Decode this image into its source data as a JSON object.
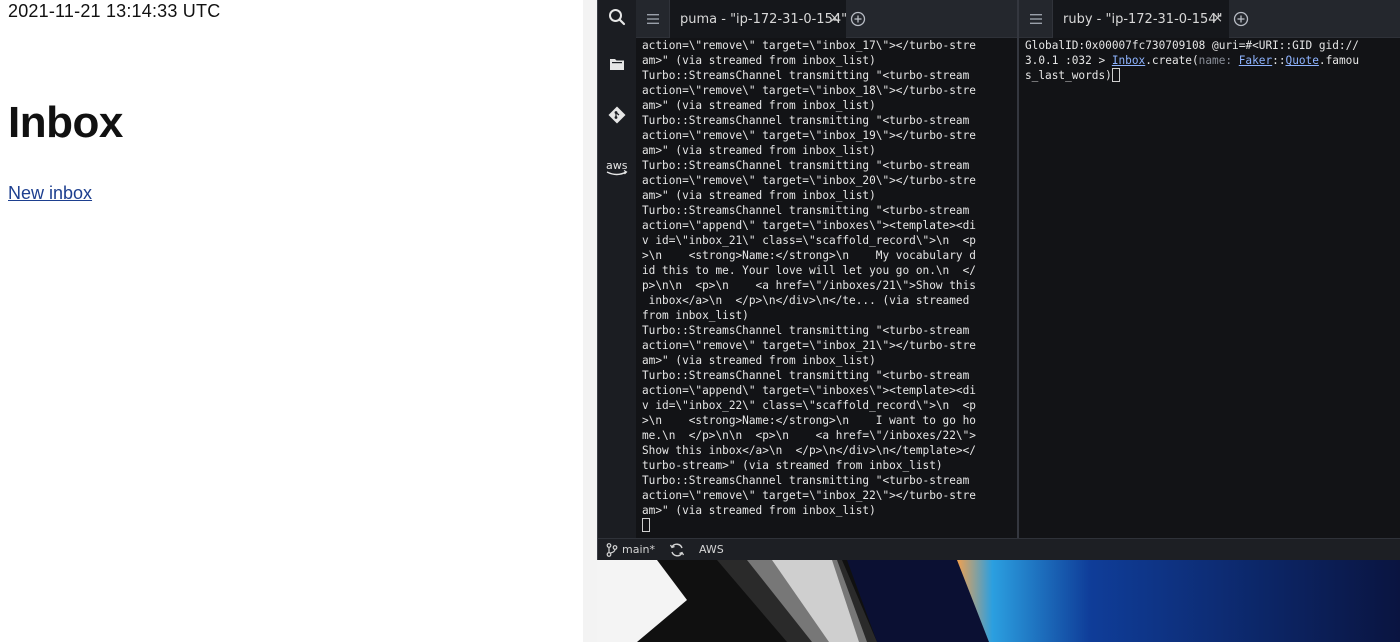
{
  "browser": {
    "timestamp": "2021-11-21 13:14:33 UTC",
    "heading": "Inbox",
    "new_link": "New inbox"
  },
  "activity_bar": {
    "icons": [
      "search-icon",
      "files-icon",
      "git-icon",
      "aws-icon"
    ],
    "aws_label": "aws"
  },
  "terminal_left": {
    "tab_title": "puma - \"ip-172-31-0-154\"",
    "tab_close": "×",
    "lines": [
      "action=\\\"remove\\\" target=\\\"inbox_17\\\"></turbo-stre",
      "am>\" (via streamed from inbox_list)",
      "Turbo::StreamsChannel transmitting \"<turbo-stream",
      "action=\\\"remove\\\" target=\\\"inbox_18\\\"></turbo-stre",
      "am>\" (via streamed from inbox_list)",
      "Turbo::StreamsChannel transmitting \"<turbo-stream",
      "action=\\\"remove\\\" target=\\\"inbox_19\\\"></turbo-stre",
      "am>\" (via streamed from inbox_list)",
      "Turbo::StreamsChannel transmitting \"<turbo-stream",
      "action=\\\"remove\\\" target=\\\"inbox_20\\\"></turbo-stre",
      "am>\" (via streamed from inbox_list)",
      "Turbo::StreamsChannel transmitting \"<turbo-stream",
      "action=\\\"append\\\" target=\\\"inboxes\\\"><template><di",
      "v id=\\\"inbox_21\\\" class=\\\"scaffold_record\\\">\\n  <p",
      ">\\n    <strong>Name:</strong>\\n    My vocabulary d",
      "id this to me. Your love will let you go on.\\n  </",
      "p>\\n\\n  <p>\\n    <a href=\\\"/inboxes/21\\\">Show this",
      " inbox</a>\\n  </p>\\n</div>\\n</te... (via streamed",
      "from inbox_list)",
      "Turbo::StreamsChannel transmitting \"<turbo-stream",
      "action=\\\"remove\\\" target=\\\"inbox_21\\\"></turbo-stre",
      "am>\" (via streamed from inbox_list)",
      "Turbo::StreamsChannel transmitting \"<turbo-stream",
      "action=\\\"append\\\" target=\\\"inboxes\\\"><template><di",
      "v id=\\\"inbox_22\\\" class=\\\"scaffold_record\\\">\\n  <p",
      ">\\n    <strong>Name:</strong>\\n    I want to go ho",
      "me.\\n  </p>\\n\\n  <p>\\n    <a href=\\\"/inboxes/22\\\">",
      "Show this inbox</a>\\n  </p>\\n</div>\\n</template></",
      "turbo-stream>\" (via streamed from inbox_list)",
      "Turbo::StreamsChannel transmitting \"<turbo-stream",
      "action=\\\"remove\\\" target=\\\"inbox_22\\\"></turbo-stre",
      "am>\" (via streamed from inbox_list)"
    ]
  },
  "terminal_right": {
    "tab_title": "ruby - \"ip-172-31-0-154\"",
    "tab_close": "×",
    "line1": "GlobalID:0x00007fc730709108 @uri=#<URI::GID gid://",
    "line2": "3.0.1 :032 > ",
    "code_const1": "Inbox",
    "code_method": ".create(",
    "code_param": "name: ",
    "code_const2": "Faker",
    "code_sep": "::",
    "code_const3": "Quote",
    "code_tail": ".famou",
    "line3": "s_last_words)"
  },
  "statusbar": {
    "branch": "main*",
    "aws": "AWS"
  }
}
